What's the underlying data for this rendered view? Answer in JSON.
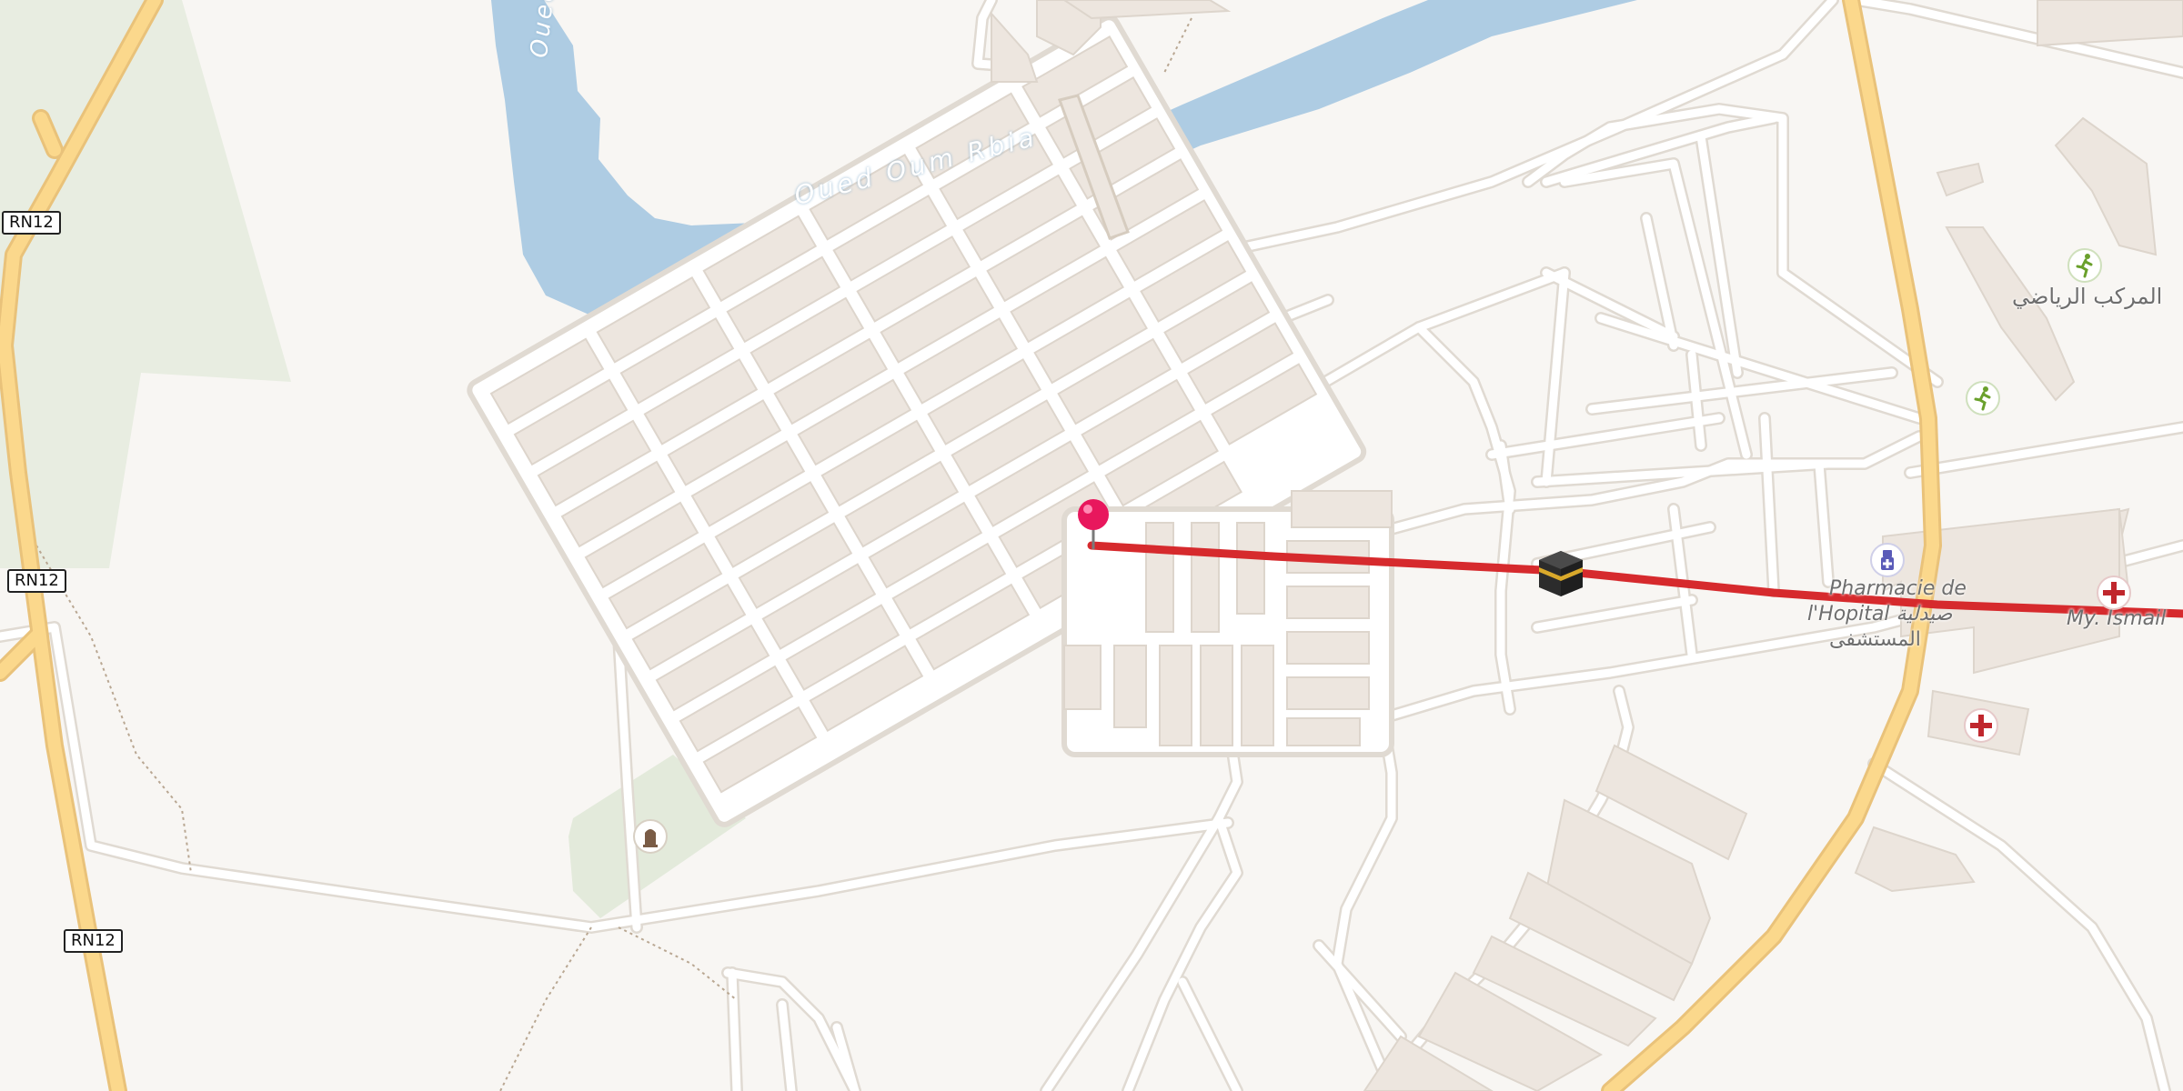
{
  "map": {
    "road_shields": [
      "RN12",
      "RN12",
      "RN12"
    ],
    "river_label": "Oued Oum Rbia",
    "river_label_partial": "Oued",
    "pois": {
      "pharmacy_label_line1": "Pharmacie de",
      "pharmacy_label_line2": "l'Hopital صيدلية",
      "pharmacy_label_line3": "المستشفى",
      "sports_label": "المركب الرياضي",
      "clinic_label": "My. Ismail"
    },
    "icons": [
      "map-pin-icon",
      "kaaba-icon",
      "pharmacy-icon",
      "sports-icon",
      "sports-icon",
      "hospital-icon",
      "hospital-icon",
      "cemetery-icon"
    ],
    "colors": {
      "background": "#f8f6f3",
      "water": "#aecce3",
      "primary_road": "#fbd88c",
      "road_casing": "#e2ddd6",
      "building": "#ede6df",
      "park": "#e8ede1",
      "route_line": "#d62a2d",
      "pin": "#e8175d"
    }
  }
}
